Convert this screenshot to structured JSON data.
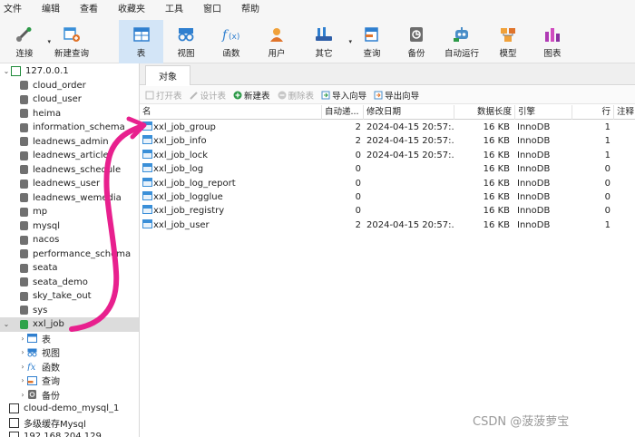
{
  "menu": [
    "文件",
    "编辑",
    "查看",
    "收藏夹",
    "工具",
    "窗口",
    "帮助"
  ],
  "toolbar": [
    {
      "label": "连接",
      "icon": "connection-icon"
    },
    {
      "label": "新建查询",
      "icon": "new-query-icon"
    },
    {
      "label": "表",
      "icon": "table-icon"
    },
    {
      "label": "视图",
      "icon": "view-icon"
    },
    {
      "label": "函数",
      "icon": "function-icon"
    },
    {
      "label": "用户",
      "icon": "user-icon"
    },
    {
      "label": "其它",
      "icon": "other-icon"
    },
    {
      "label": "查询",
      "icon": "query-icon"
    },
    {
      "label": "备份",
      "icon": "backup-icon"
    },
    {
      "label": "自动运行",
      "icon": "robot-icon"
    },
    {
      "label": "模型",
      "icon": "model-icon"
    },
    {
      "label": "图表",
      "icon": "chart-icon"
    }
  ],
  "sidebar": {
    "connection": "127.0.0.1",
    "databases": [
      "cloud_order",
      "cloud_user",
      "heima",
      "information_schema",
      "leadnews_admin",
      "leadnews_article",
      "leadnews_schedule",
      "leadnews_user",
      "leadnews_wemedia",
      "mp",
      "mysql",
      "nacos",
      "performance_schema",
      "seata",
      "seata_demo",
      "sky_take_out",
      "sys",
      "xxl_job"
    ],
    "selected_db": "xxl_job",
    "db_children": [
      "表",
      "视图",
      "函数",
      "查询",
      "备份"
    ],
    "other_connections": [
      "cloud-demo_mysql_1",
      "多级缓存Mysql",
      "192.168.204.129"
    ]
  },
  "tab": {
    "label": "对象"
  },
  "objbar": [
    {
      "label": "打开表",
      "enabled": false
    },
    {
      "label": "设计表",
      "enabled": false
    },
    {
      "label": "新建表",
      "enabled": true
    },
    {
      "label": "删除表",
      "enabled": false
    },
    {
      "label": "导入向导",
      "enabled": true
    },
    {
      "label": "导出向导",
      "enabled": true
    }
  ],
  "table": {
    "headers": [
      "名",
      "自动递...",
      "修改日期",
      "数据长度",
      "引擎",
      "行",
      "注释"
    ],
    "rows": [
      [
        "xxl_job_group",
        "2",
        "2024-04-15 20:57:...",
        "16 KB",
        "InnoDB",
        "1",
        ""
      ],
      [
        "xxl_job_info",
        "2",
        "2024-04-15 20:57:...",
        "16 KB",
        "InnoDB",
        "1",
        ""
      ],
      [
        "xxl_job_lock",
        "0",
        "2024-04-15 20:57:...",
        "16 KB",
        "InnoDB",
        "1",
        ""
      ],
      [
        "xxl_job_log",
        "0",
        "",
        "16 KB",
        "InnoDB",
        "0",
        ""
      ],
      [
        "xxl_job_log_report",
        "0",
        "",
        "16 KB",
        "InnoDB",
        "0",
        ""
      ],
      [
        "xxl_job_logglue",
        "0",
        "",
        "16 KB",
        "InnoDB",
        "0",
        ""
      ],
      [
        "xxl_job_registry",
        "0",
        "",
        "16 KB",
        "InnoDB",
        "0",
        ""
      ],
      [
        "xxl_job_user",
        "2",
        "2024-04-15 20:57:...",
        "16 KB",
        "InnoDB",
        "1",
        ""
      ]
    ]
  },
  "watermark": "CSDN @菠菠萝宝",
  "colors": {
    "arrow": "#e8208e",
    "selected_toolbar": "#d3e5f7",
    "db_green": "#2fa34a"
  }
}
